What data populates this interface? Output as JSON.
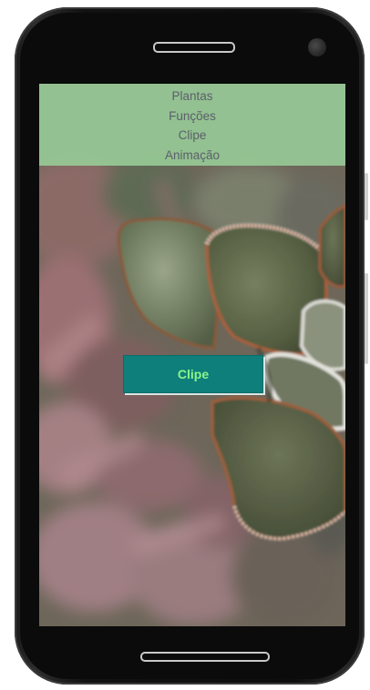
{
  "nav": {
    "items": [
      {
        "label": "Plantas"
      },
      {
        "label": "Funções"
      },
      {
        "label": "Clipe"
      },
      {
        "label": "Animação"
      }
    ]
  },
  "main": {
    "button_label": "Clipe"
  },
  "colors": {
    "nav_background": "#98ce98",
    "nav_text": "#5b5f6a",
    "button_background": "#0e7f7a",
    "button_text": "#8cf58c"
  },
  "icons": {
    "background_image": "succulent-plant-photo"
  }
}
